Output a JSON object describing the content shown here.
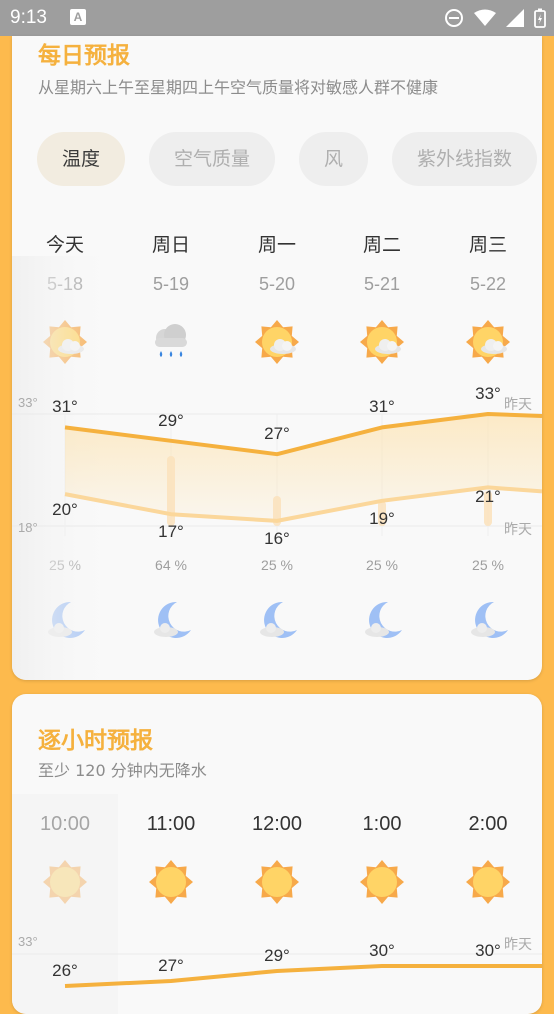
{
  "status": {
    "time": "9:13"
  },
  "daily": {
    "title": "每日预报",
    "subtitle": "从星期六上午至星期四上午空气质量将对敏感人群不健康",
    "tabs": [
      {
        "label": "温度",
        "active": true
      },
      {
        "label": "空气质量",
        "active": false
      },
      {
        "label": "风",
        "active": false
      },
      {
        "label": "紫外线指数",
        "active": false
      }
    ],
    "axis_high": "33°",
    "axis_low": "18°",
    "yesterday": "昨天",
    "days": [
      {
        "name": "今天",
        "date": "5-18",
        "day_icon": "sun-cloud-icon",
        "high": "31°",
        "low": "20°",
        "precip": "25 %",
        "night_icon": "moon-cloud-icon"
      },
      {
        "name": "周日",
        "date": "5-19",
        "day_icon": "rain-icon",
        "high": "29°",
        "low": "17°",
        "precip": "64 %",
        "night_icon": "moon-cloud-icon"
      },
      {
        "name": "周一",
        "date": "5-20",
        "day_icon": "sun-cloud-icon",
        "high": "27°",
        "low": "16°",
        "precip": "25 %",
        "night_icon": "moon-cloud-icon"
      },
      {
        "name": "周二",
        "date": "5-21",
        "day_icon": "sun-cloud-icon",
        "high": "31°",
        "low": "19°",
        "precip": "25 %",
        "night_icon": "moon-cloud-icon"
      },
      {
        "name": "周三",
        "date": "5-22",
        "day_icon": "sun-cloud-icon",
        "high": "33°",
        "low": "21°",
        "precip": "25 %",
        "night_icon": "moon-cloud-icon"
      }
    ]
  },
  "hourly": {
    "title": "逐小时预报",
    "subtitle": "至少 120 分钟内无降水",
    "axis_high": "33°",
    "yesterday": "昨天",
    "hours": [
      {
        "time": "10:00",
        "icon": "sun-icon",
        "temp": "26°"
      },
      {
        "time": "11:00",
        "icon": "sun-icon",
        "temp": "27°"
      },
      {
        "time": "12:00",
        "icon": "sun-icon",
        "temp": "29°"
      },
      {
        "time": "1:00",
        "icon": "sun-icon",
        "temp": "30°"
      },
      {
        "time": "2:00",
        "icon": "sun-icon",
        "temp": "30°"
      }
    ]
  },
  "colors": {
    "accent": "#F5B13E",
    "background": "#FDBA4D",
    "card": "#F9F9F9"
  }
}
